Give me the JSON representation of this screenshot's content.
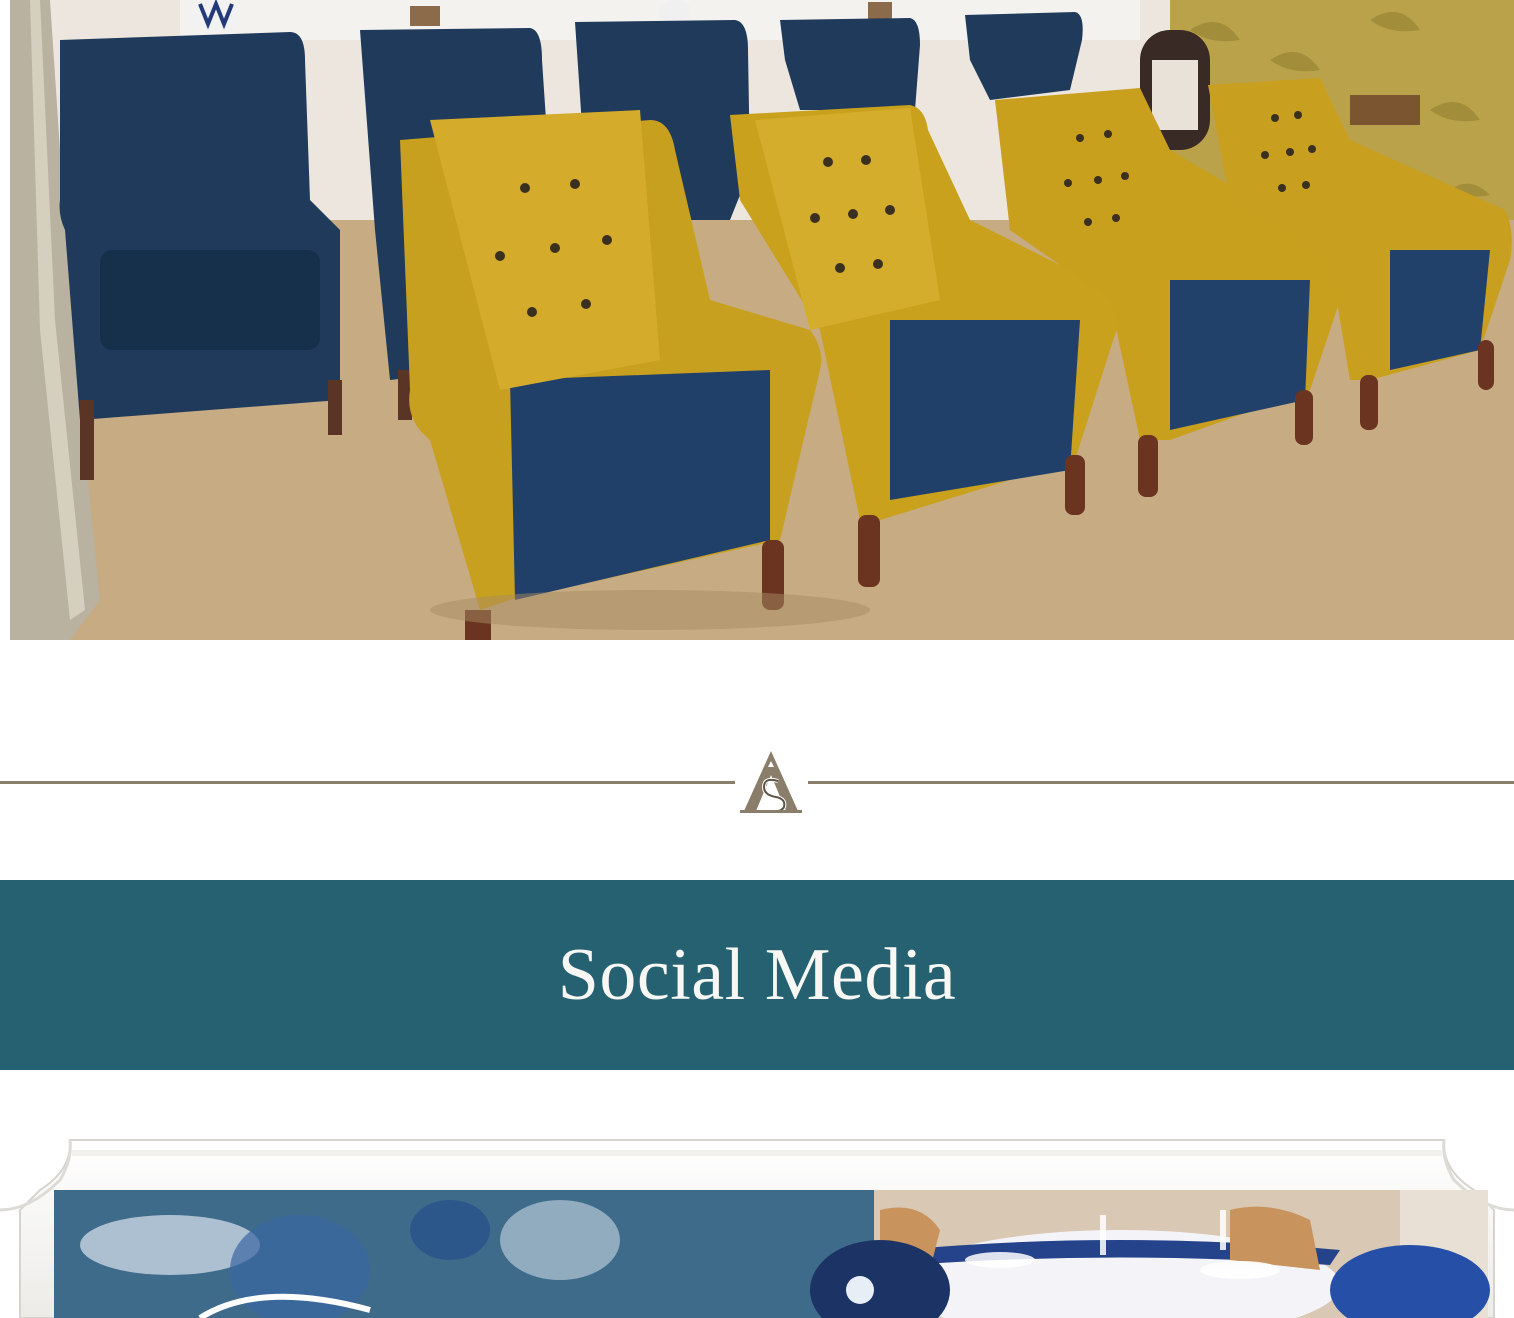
{
  "hero_image": {
    "description_icon": "armchairs-photo",
    "colors": {
      "navy": "#1f3a5a",
      "mustard": "#c9a11c",
      "carpet": "#c8ad85",
      "wall": "#ece7e0"
    }
  },
  "divider": {
    "logo_icon": "ornamental-a-logo-icon",
    "line_color": "#8a7d6a"
  },
  "social_section": {
    "heading": "Social Media",
    "banner_color": "#266172"
  },
  "social_feed": {
    "frame_icon": "scalloped-frame-icon",
    "image_icon": "dining-room-photo"
  }
}
